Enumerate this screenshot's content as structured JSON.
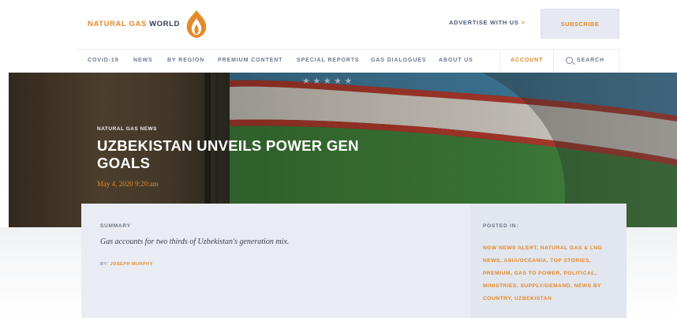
{
  "header": {
    "logo_text_brand": "NATURAL GAS",
    "logo_text_world": "WORLD",
    "logo_icon": "flame-icon",
    "advertise_label": "ADVERTISE WITH US",
    "advertise_arrow": ">",
    "subscribe_label": "SUBSCRIBE"
  },
  "nav": {
    "items": [
      "COVID-19",
      "NEWS",
      "BY REGION",
      "PREMIUM CONTENT",
      "SPECIAL REPORTS",
      "GAS DIALOGUES",
      "ABOUT US"
    ],
    "account_label": "ACCOUNT",
    "search_label": "SEARCH"
  },
  "hero": {
    "kicker": "NATURAL GAS NEWS",
    "headline": "UZBEKISTAN UNVEILS POWER GEN GOALS",
    "date": "May 4, 2020 9:20:am"
  },
  "summary": {
    "label": "SUMMARY",
    "text": "Gas accounts for two thirds of Uzbekistan's generation mix.",
    "by_label": "BY:",
    "author": "JOSEPH MURPHY"
  },
  "posted_in": {
    "label": "POSTED IN:",
    "tags": "NGW NEWS ALERT, NATURAL GAS & LNG NEWS, ASIA/OCEANIA, TOP STORIES, PREMIUM, GAS TO POWER, POLITICAL, MINISTRIES, SUPPLY/DEMAND, NEWS BY COUNTRY, UZBEKISTAN"
  },
  "colors": {
    "accent": "#e48a2a",
    "navy": "#2f3a52",
    "card_bg": "#e9ecf2"
  }
}
